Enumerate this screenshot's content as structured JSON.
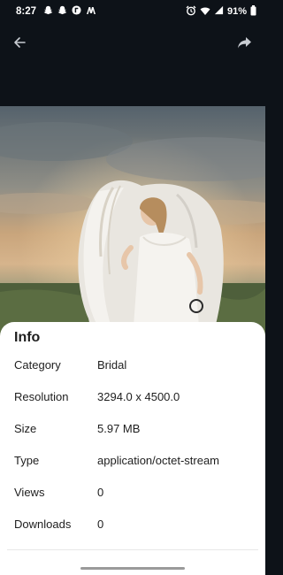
{
  "status_bar": {
    "time": "8:27",
    "battery": "91%",
    "left_icons": [
      "snapchat-icon",
      "snapchat-icon",
      "app-icon",
      "m-icon"
    ],
    "right_icons": [
      "alarm-icon",
      "wifi-icon",
      "signal-icon",
      "battery-icon"
    ]
  },
  "toolbar": {
    "back_icon": "arrow-back-icon",
    "share_icon": "share-icon"
  },
  "info": {
    "title": "Info",
    "rows": [
      {
        "label": "Category",
        "value": "Bridal"
      },
      {
        "label": "Resolution",
        "value": "3294.0 x 4500.0"
      },
      {
        "label": "Size",
        "value": "5.97 MB"
      },
      {
        "label": "Type",
        "value": "application/octet-stream"
      },
      {
        "label": "Views",
        "value": "0"
      },
      {
        "label": "Downloads",
        "value": "0"
      }
    ]
  },
  "colors": {
    "background": "#0d1218",
    "sheet": "#ffffff",
    "text": "#1e1e1e",
    "icon": "#c8ccd2"
  }
}
